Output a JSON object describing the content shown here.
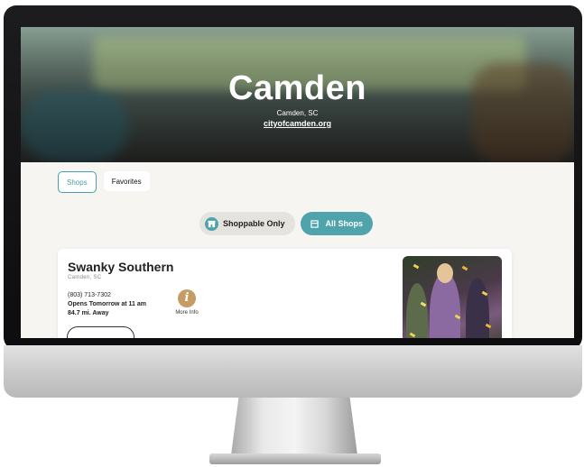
{
  "hero": {
    "title": "Camden",
    "location": "Camden, SC",
    "website": "cityofcamden.org"
  },
  "tabs": [
    {
      "label": "Shops",
      "active": true
    },
    {
      "label": "Favorites",
      "active": false
    }
  ],
  "filters": [
    {
      "label": "Shoppable Only",
      "icon": "store-icon",
      "selected": false
    },
    {
      "label": "All Shops",
      "icon": "grid-icon",
      "selected": true
    }
  ],
  "shop": {
    "name": "Swanky Southern",
    "city": "Camden, SC",
    "phone": "(803) 713-7302",
    "hours": "Opens Tomorrow at 11 am",
    "distance": "84.7 mi. Away",
    "more_info_label": "More Info",
    "info_icon": "info-icon"
  },
  "colors": {
    "accent": "#4fa3aa",
    "info_icon": "#c69c65"
  }
}
